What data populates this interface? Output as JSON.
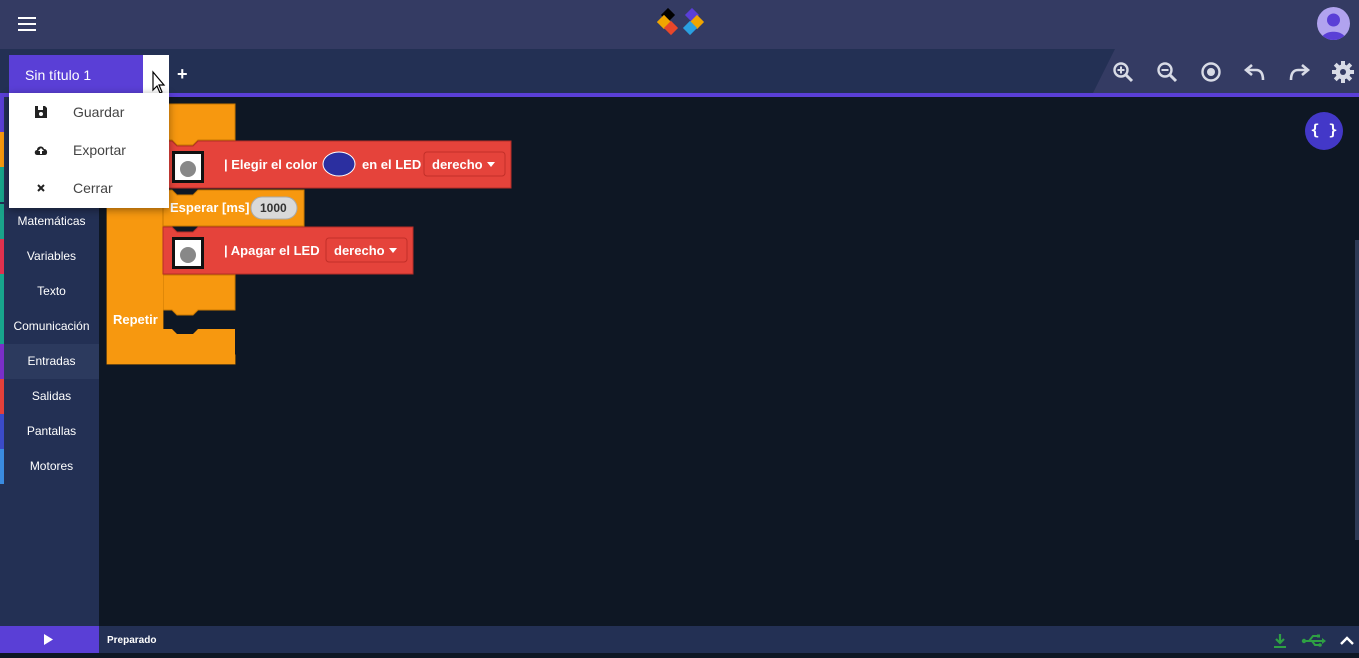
{
  "tab": {
    "title": "Sin título 1",
    "add_label": "+"
  },
  "file_menu": {
    "items": [
      {
        "label": "Guardar",
        "icon": "floppy-icon"
      },
      {
        "label": "Exportar",
        "icon": "cloud-upload-icon"
      },
      {
        "label": "Cerrar",
        "icon": "close-icon"
      }
    ]
  },
  "toolbar": {
    "icons": [
      "zoom-in-icon",
      "zoom-out-icon",
      "center-icon",
      "undo-icon",
      "redo-icon",
      "gear-icon"
    ]
  },
  "sidebar": {
    "categories": [
      {
        "label": "Matemáticas",
        "color": "#1aa38a"
      },
      {
        "label": "Variables",
        "color": "#e0314e"
      },
      {
        "label": "Texto",
        "color": "#18a58c"
      },
      {
        "label": "Comunicación",
        "color": "#18a58c"
      },
      {
        "label": "Entradas",
        "color": "#7a2fc8"
      },
      {
        "label": "Salidas",
        "color": "#e3403a"
      },
      {
        "label": "Pantallas",
        "color": "#3b4bc8"
      },
      {
        "label": "Motores",
        "color": "#3a8be0"
      }
    ],
    "hidden_colors": [
      "#5a3fd6",
      "#f7980f",
      "#18a58c"
    ]
  },
  "blocks": {
    "set_color_label": "| Elegir el color",
    "on_led_label": "en el LED",
    "led_option_1": "derecho",
    "color_value": "#2b2fa0",
    "wait_label": "Esperar [ms]",
    "wait_value": "1000",
    "off_label": "| Apagar el LED",
    "led_option_2": "derecho",
    "repeat_label": "Repetir"
  },
  "code_button": {
    "label": "{ }"
  },
  "status_bar": {
    "text": "Preparado"
  },
  "colors": {
    "accent": "#5a3fd6",
    "loop_block": "#f7980f",
    "led_block": "#e5433b",
    "workspace": "#0e1724",
    "usb_green": "#2ea043"
  }
}
